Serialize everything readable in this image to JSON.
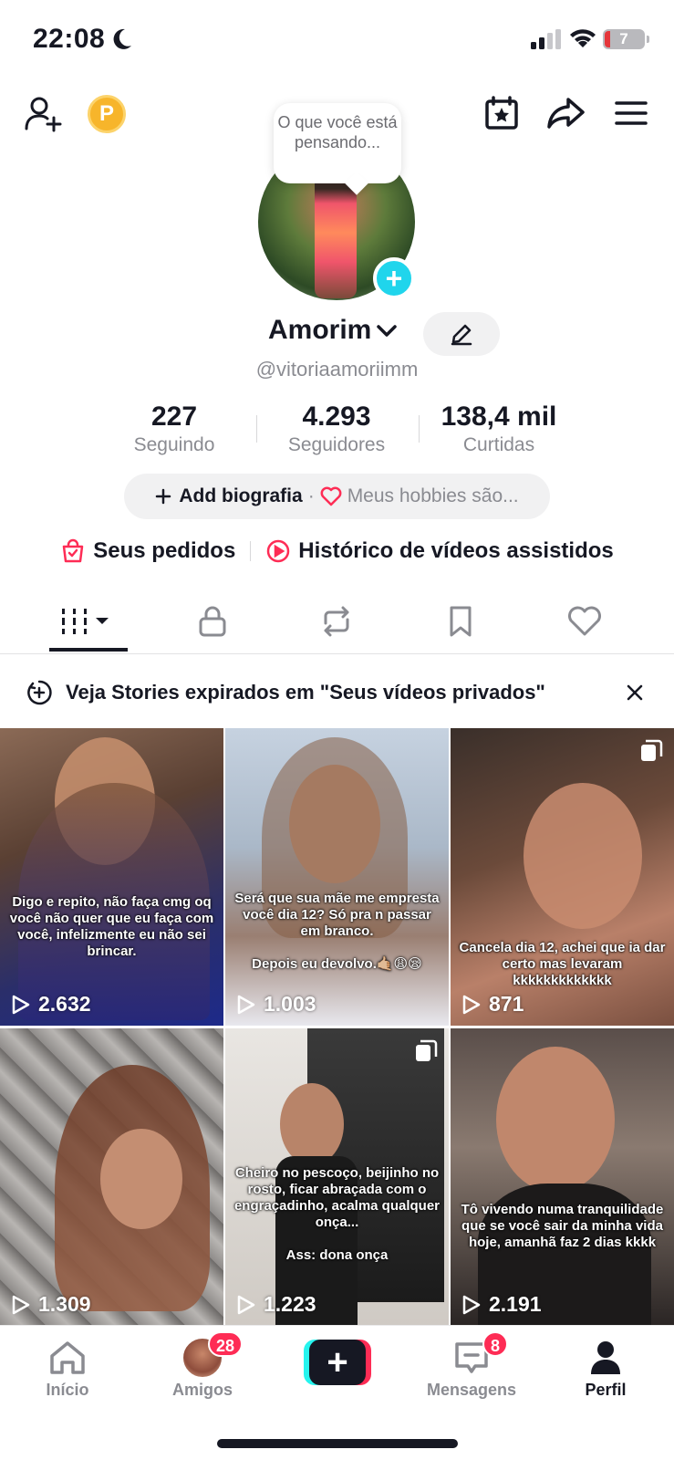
{
  "status_bar": {
    "time": "22:08",
    "battery": "7"
  },
  "profile": {
    "thought_bubble": "O que você está pensando...",
    "name": "Amorim",
    "handle": "@vitoriaamoriimm"
  },
  "stats": [
    {
      "value": "227",
      "label": "Seguindo"
    },
    {
      "value": "4.293",
      "label": "Seguidores"
    },
    {
      "value": "138,4 mil",
      "label": "Curtidas"
    }
  ],
  "bio": {
    "add_label": "Add biografia",
    "separator": "·",
    "hobbies_placeholder": "Meus hobbies são..."
  },
  "links": {
    "orders": "Seus pedidos",
    "history": "Histórico de vídeos assistidos"
  },
  "banner": {
    "text": "Veja Stories expirados em \"Seus vídeos privados\""
  },
  "videos": [
    {
      "caption": "Digo e repito, não faça cmg oq você não quer que eu faça com você, infelizmente eu não sei brincar.",
      "views": "2.632"
    },
    {
      "caption": "Será que sua mãe me empresta você dia 12? Só pra n passar em branco.\n\nDepois eu devolvo.🤙🏼😩😪",
      "views": "1.003"
    },
    {
      "caption": "Cancela dia 12, achei que ia dar certo mas levaram kkkkkkkkkkkkk",
      "views": "871"
    },
    {
      "caption": "",
      "views": "1.309"
    },
    {
      "caption": "Cheiro no pescoço, beijinho no rosto, ficar abraçada com o engraçadinho, acalma qualquer onça...\n\nAss: dona onça",
      "views": "1.223"
    },
    {
      "caption": "Tô vivendo numa tranquilidade que se você sair da minha vida hoje, amanhã faz 2 dias kkkk",
      "views": "2.191"
    }
  ],
  "bottom_nav": {
    "home": "Início",
    "friends": "Amigos",
    "friends_badge": "28",
    "messages": "Mensagens",
    "messages_badge": "8",
    "profile": "Perfil",
    "create": "+"
  },
  "colors": {
    "accent": "#fe2c55",
    "cyan": "#25f4ee",
    "text": "#161823",
    "muted": "#8a8b91"
  }
}
